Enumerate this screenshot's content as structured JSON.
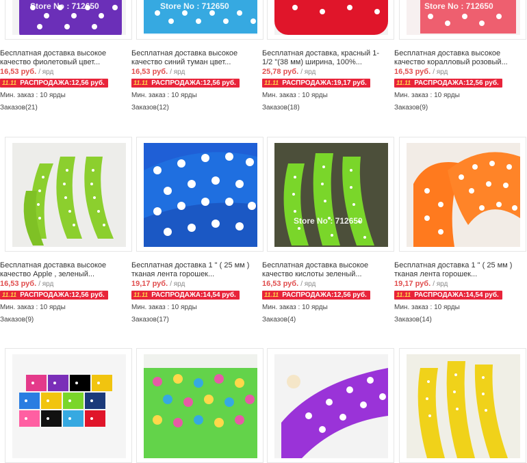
{
  "products": [
    {
      "title": "Бесплатная доставка высокое качество фиолетовый цвет...",
      "price": "16,53 руб.",
      "unit": "/ ярд",
      "sale_tag": "11.11",
      "sale": "РАСПРОДАЖА:12,56 руб.",
      "min_order": "Мин. заказ : 10 ярды",
      "orders": "Заказов(21)",
      "watermark": "Store No : 712650",
      "colors": {
        "bg": "#f3f3f3",
        "ribbon": "#6b2fb8",
        "dot": "#ffffff"
      }
    },
    {
      "title": "Бесплатная доставка высокое качество синий туман цвет...",
      "price": "16,53 руб.",
      "unit": "/ ярд",
      "sale_tag": "11.11",
      "sale": "РАСПРОДАЖА:12,56 руб.",
      "min_order": "Мин. заказ : 10 ярды",
      "orders": "Заказов(12)",
      "watermark": "Store No : 712650",
      "colors": {
        "bg": "#eef6fb",
        "ribbon": "#36a9e1",
        "dot": "#ffffff"
      }
    },
    {
      "title": "Бесплатная доставка, красный 1-1/2 \"(38 мм) ширина, 100%...",
      "price": "25,78 руб.",
      "unit": "/ ярд",
      "sale_tag": "11.11",
      "sale": "РАСПРОДАЖА:19,17 руб.",
      "min_order": "Мин. заказ : 10 ярды",
      "orders": "Заказов(18)",
      "watermark": "",
      "colors": {
        "bg": "#f2f2f2",
        "ribbon": "#e0152a",
        "dot": "#ffffff"
      }
    },
    {
      "title": "Бесплатная доставка высокое качество коралловый розовый...",
      "price": "16,53 руб.",
      "unit": "/ ярд",
      "sale_tag": "11.11",
      "sale": "РАСПРОДАЖА:12,56 руб.",
      "min_order": "Мин. заказ : 10 ярды",
      "orders": "Заказов(9)",
      "watermark": "Store No : 712650",
      "colors": {
        "bg": "#f7f0f0",
        "ribbon": "#ee5f6f",
        "dot": "#ffffff"
      }
    },
    {
      "title": "Бесплатная доставка высокое качество Apple , зеленый...",
      "price": "16,53 руб.",
      "unit": "/ ярд",
      "sale_tag": "11.11",
      "sale": "РАСПРОДАЖА:12,56 руб.",
      "min_order": "Мин. заказ : 10 ярды",
      "orders": "Заказов(9)",
      "watermark": "",
      "colors": {
        "bg": "#f4f4f0",
        "ribbon": "#8ccf2e",
        "dot": "#ffffff"
      }
    },
    {
      "title": "Бесплатная доставка 1 \" ( 25 мм ) тканая лента горошек...",
      "price": "19,17 руб.",
      "unit": "/ ярд",
      "sale_tag": "11.11",
      "sale": "РАСПРОДАЖА:14,54 руб.",
      "min_order": "Мин. заказ : 10 ярды",
      "orders": "Заказов(17)",
      "watermark": "",
      "colors": {
        "bg": "#1f5fd6",
        "ribbon": "#1f6fe0",
        "dot": "#ffffff"
      }
    },
    {
      "title": "Бесплатная доставка высокое качество кислоты зеленый...",
      "price": "16,53 руб.",
      "unit": "/ ярд",
      "sale_tag": "11.11",
      "sale": "РАСПРОДАЖА:12,56 руб.",
      "min_order": "Мин. заказ : 10 ярды",
      "orders": "Заказов(4)",
      "watermark": "Store No : 712650",
      "colors": {
        "bg": "#4c4f3a",
        "ribbon": "#7ad62a",
        "dot": "#ffffff"
      }
    },
    {
      "title": "Бесплатная доставка 1 \" ( 25 мм ) тканая лента горошек...",
      "price": "19,17 руб.",
      "unit": "/ ярд",
      "sale_tag": "11.11",
      "sale": "РАСПРОДАЖА:14,54 руб.",
      "min_order": "Мин. заказ : 10 ярды",
      "orders": "Заказов(14)",
      "watermark": "",
      "colors": {
        "bg": "#f2ece6",
        "ribbon": "#ff7a1e",
        "dot": "#ffffff"
      }
    },
    {
      "title": "",
      "watermark": "",
      "colors": {
        "bg": "#f5f5f5",
        "ribbon": "#e43a8a",
        "dot": "#ffffff"
      }
    },
    {
      "title": "",
      "watermark": "",
      "colors": {
        "bg": "#f0f2ee",
        "ribbon": "#63d34a",
        "dot": "#e65aa6"
      }
    },
    {
      "title": "",
      "watermark": "",
      "colors": {
        "bg": "#f3f3f3",
        "ribbon": "#9a33d8",
        "dot": "#ffffff"
      }
    },
    {
      "title": "",
      "watermark": "",
      "colors": {
        "bg": "#f0efe6",
        "ribbon": "#f0d21a",
        "dot": "#ffffff"
      }
    }
  ]
}
